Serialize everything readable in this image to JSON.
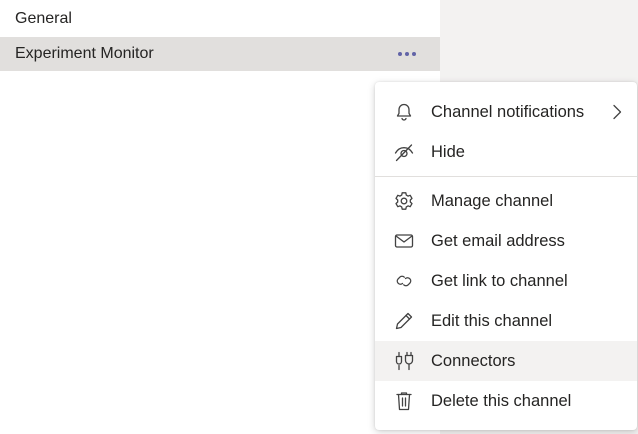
{
  "channels": [
    {
      "label": "General"
    },
    {
      "label": "Experiment Monitor"
    }
  ],
  "more_button_label": "More options",
  "menu": {
    "items": [
      {
        "label": "Channel notifications",
        "icon": "bell-icon"
      },
      {
        "label": "Hide",
        "icon": "hide-icon"
      },
      {
        "label": "Manage channel",
        "icon": "gear-icon"
      },
      {
        "label": "Get email address",
        "icon": "mail-icon"
      },
      {
        "label": "Get link to channel",
        "icon": "link-icon"
      },
      {
        "label": "Edit this channel",
        "icon": "pencil-icon"
      },
      {
        "label": "Connectors",
        "icon": "plug-icon"
      },
      {
        "label": "Delete this channel",
        "icon": "trash-icon"
      }
    ]
  },
  "colors": {
    "accent": "#6264a7",
    "selected_row": "#e1dfdd",
    "pane_background": "#f3f2f1",
    "text": "#252423"
  }
}
